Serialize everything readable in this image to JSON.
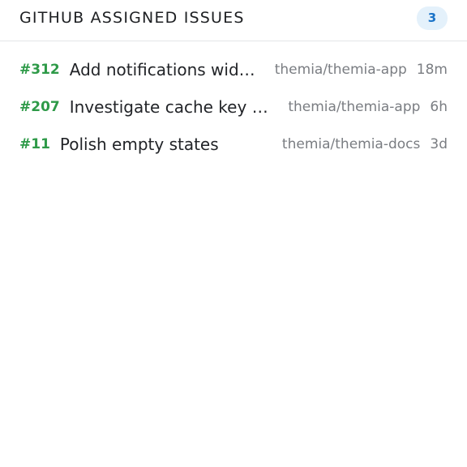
{
  "header": {
    "title": "GITHUB ASSIGNED ISSUES",
    "count": "3"
  },
  "issues": [
    {
      "number": "#312",
      "title": "Add notifications widget",
      "repo": "themia/themia-app",
      "age": "18m"
    },
    {
      "number": "#207",
      "title": "Investigate cache key collisions",
      "repo": "themia/themia-app",
      "age": "6h"
    },
    {
      "number": "#11",
      "title": "Polish empty states",
      "repo": "themia/themia-docs",
      "age": "3d"
    }
  ],
  "colors": {
    "issue_number": "#2e9a48",
    "badge_bg": "#e4f1fb",
    "badge_text": "#1a73c8"
  }
}
